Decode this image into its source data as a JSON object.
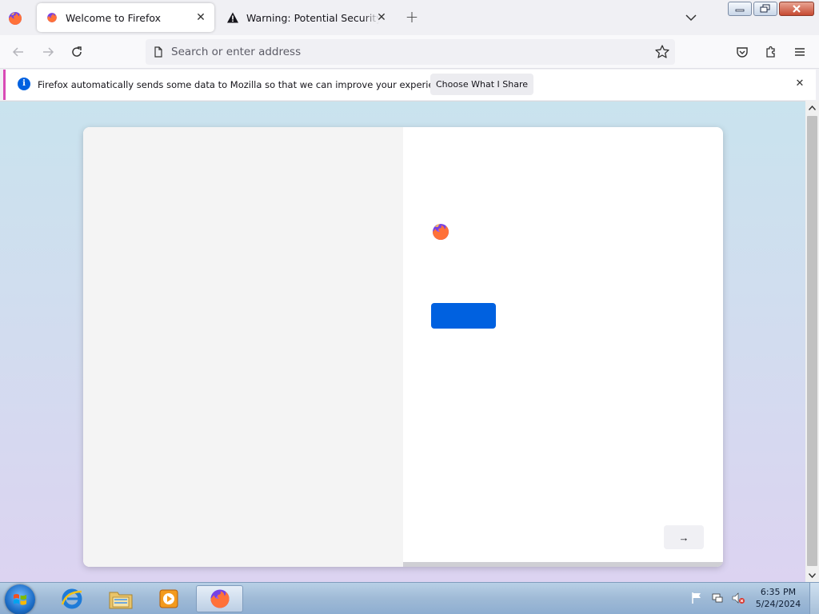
{
  "browser": {
    "tabs": [
      {
        "title": "Welcome to Firefox",
        "icon": "firefox-icon",
        "active": true
      },
      {
        "title": "Warning: Potential Security Risk Ahead",
        "icon": "warning-icon",
        "active": false
      }
    ],
    "tab_close_glyph": "✕",
    "new_tab_glyph": "+"
  },
  "navbar": {
    "search_placeholder": "Search or enter address",
    "icons": [
      "back-icon",
      "forward-icon",
      "reload-icon",
      "page-icon",
      "star-icon",
      "pocket-icon",
      "extensions-icon",
      "menu-icon"
    ]
  },
  "notification": {
    "message": "Firefox automatically sends some data to Mozilla so that we can improve your experience.",
    "button_label": "Choose What I Share",
    "info_glyph": "i",
    "close_glyph": "✕",
    "accent_color": "#d94bb6"
  },
  "onboarding": {
    "primary_color": "#0061e0",
    "next_glyph": "→"
  },
  "taskbar": {
    "apps": [
      "internet-explorer-icon",
      "file-explorer-icon",
      "media-player-icon",
      "firefox-icon"
    ],
    "clock_time": "6:35 PM",
    "clock_date": "5/24/2024"
  }
}
